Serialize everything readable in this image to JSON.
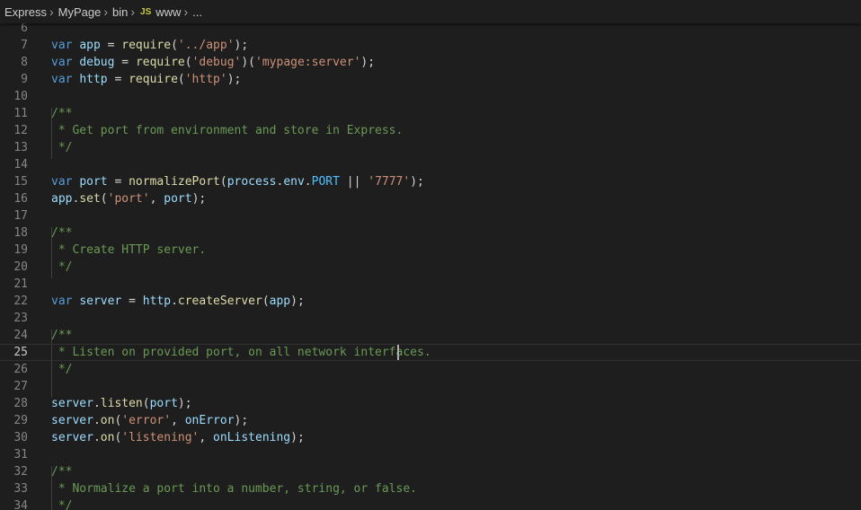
{
  "breadcrumbs": {
    "items": [
      "Express",
      "MyPage",
      "bin"
    ],
    "file_icon": "JS",
    "file_name": "www",
    "trailing": "..."
  },
  "editor": {
    "cursor_line": 25,
    "lines": [
      {
        "n": "6",
        "tokens": []
      },
      {
        "n": "7",
        "tokens": [
          [
            "kw",
            "var"
          ],
          [
            "op",
            " "
          ],
          [
            "var",
            "app"
          ],
          [
            "op",
            " = "
          ],
          [
            "fn",
            "require"
          ],
          [
            "op",
            "("
          ],
          [
            "str",
            "'../app'"
          ],
          [
            "op",
            ");"
          ]
        ]
      },
      {
        "n": "8",
        "tokens": [
          [
            "kw",
            "var"
          ],
          [
            "op",
            " "
          ],
          [
            "var",
            "debug"
          ],
          [
            "op",
            " = "
          ],
          [
            "fn",
            "require"
          ],
          [
            "op",
            "("
          ],
          [
            "str",
            "'debug'"
          ],
          [
            "op",
            ")("
          ],
          [
            "str",
            "'mypage:server'"
          ],
          [
            "op",
            ");"
          ]
        ]
      },
      {
        "n": "9",
        "tokens": [
          [
            "kw",
            "var"
          ],
          [
            "op",
            " "
          ],
          [
            "var",
            "http"
          ],
          [
            "op",
            " = "
          ],
          [
            "fn",
            "require"
          ],
          [
            "op",
            "("
          ],
          [
            "str",
            "'http'"
          ],
          [
            "op",
            ");"
          ]
        ]
      },
      {
        "n": "10",
        "tokens": []
      },
      {
        "n": "11",
        "tokens": [
          [
            "cm",
            "/**"
          ]
        ]
      },
      {
        "n": "12",
        "tokens": [
          [
            "cm",
            " * Get port from environment and store in Express."
          ]
        ]
      },
      {
        "n": "13",
        "tokens": [
          [
            "cm",
            " */"
          ]
        ]
      },
      {
        "n": "14",
        "tokens": []
      },
      {
        "n": "15",
        "tokens": [
          [
            "kw",
            "var"
          ],
          [
            "op",
            " "
          ],
          [
            "var",
            "port"
          ],
          [
            "op",
            " = "
          ],
          [
            "fn",
            "normalizePort"
          ],
          [
            "op",
            "("
          ],
          [
            "var",
            "process"
          ],
          [
            "op",
            "."
          ],
          [
            "var",
            "env"
          ],
          [
            "op",
            "."
          ],
          [
            "cst",
            "PORT"
          ],
          [
            "op",
            " || "
          ],
          [
            "str",
            "'7777'"
          ],
          [
            "op",
            ");"
          ]
        ]
      },
      {
        "n": "16",
        "tokens": [
          [
            "var",
            "app"
          ],
          [
            "op",
            "."
          ],
          [
            "fn",
            "set"
          ],
          [
            "op",
            "("
          ],
          [
            "str",
            "'port'"
          ],
          [
            "op",
            ", "
          ],
          [
            "var",
            "port"
          ],
          [
            "op",
            ");"
          ]
        ]
      },
      {
        "n": "17",
        "tokens": []
      },
      {
        "n": "18",
        "tokens": [
          [
            "cm",
            "/**"
          ]
        ]
      },
      {
        "n": "19",
        "tokens": [
          [
            "cm",
            " * Create HTTP server."
          ]
        ]
      },
      {
        "n": "20",
        "tokens": [
          [
            "cm",
            " */"
          ]
        ]
      },
      {
        "n": "21",
        "tokens": []
      },
      {
        "n": "22",
        "tokens": [
          [
            "kw",
            "var"
          ],
          [
            "op",
            " "
          ],
          [
            "var",
            "server"
          ],
          [
            "op",
            " = "
          ],
          [
            "var",
            "http"
          ],
          [
            "op",
            "."
          ],
          [
            "fn",
            "createServer"
          ],
          [
            "op",
            "("
          ],
          [
            "var",
            "app"
          ],
          [
            "op",
            ");"
          ]
        ]
      },
      {
        "n": "23",
        "tokens": []
      },
      {
        "n": "24",
        "tokens": [
          [
            "cm",
            "/**"
          ]
        ]
      },
      {
        "n": "25",
        "tokens": [
          [
            "cm",
            " * Listen on provided port, on all network interfaces."
          ]
        ]
      },
      {
        "n": "26",
        "tokens": [
          [
            "cm",
            " */"
          ]
        ]
      },
      {
        "n": "27",
        "tokens": []
      },
      {
        "n": "28",
        "tokens": [
          [
            "var",
            "server"
          ],
          [
            "op",
            "."
          ],
          [
            "fn",
            "listen"
          ],
          [
            "op",
            "("
          ],
          [
            "var",
            "port"
          ],
          [
            "op",
            ");"
          ]
        ]
      },
      {
        "n": "29",
        "tokens": [
          [
            "var",
            "server"
          ],
          [
            "op",
            "."
          ],
          [
            "fn",
            "on"
          ],
          [
            "op",
            "("
          ],
          [
            "str",
            "'error'"
          ],
          [
            "op",
            ", "
          ],
          [
            "var",
            "onError"
          ],
          [
            "op",
            ");"
          ]
        ]
      },
      {
        "n": "30",
        "tokens": [
          [
            "var",
            "server"
          ],
          [
            "op",
            "."
          ],
          [
            "fn",
            "on"
          ],
          [
            "op",
            "("
          ],
          [
            "str",
            "'listening'"
          ],
          [
            "op",
            ", "
          ],
          [
            "var",
            "onListening"
          ],
          [
            "op",
            ");"
          ]
        ]
      },
      {
        "n": "31",
        "tokens": []
      },
      {
        "n": "32",
        "tokens": [
          [
            "cm",
            "/**"
          ]
        ]
      },
      {
        "n": "33",
        "tokens": [
          [
            "cm",
            " * Normalize a port into a number, string, or false."
          ]
        ]
      },
      {
        "n": "34",
        "tokens": [
          [
            "cm",
            " */"
          ]
        ]
      }
    ]
  }
}
